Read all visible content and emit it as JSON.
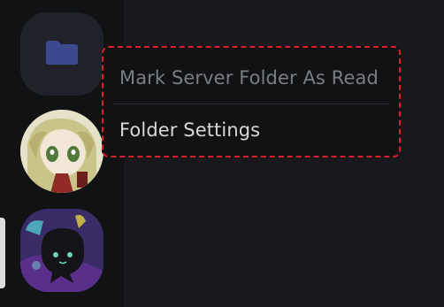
{
  "guild_rail": {
    "folder": {
      "icon": "folder-icon",
      "color": "#3b4a8f"
    },
    "servers": [
      {
        "icon": "server-avatar-anime-girl"
      },
      {
        "icon": "server-avatar-dark-creature"
      }
    ]
  },
  "context_menu": {
    "items": [
      {
        "label": "Mark Server Folder As Read",
        "enabled": false
      },
      {
        "label": "Folder Settings",
        "enabled": true
      }
    ]
  },
  "colors": {
    "highlight_border": "#e11d2b",
    "menu_bg": "#111214",
    "disabled_text": "#7a7d84",
    "active_text": "#d7d8da"
  }
}
